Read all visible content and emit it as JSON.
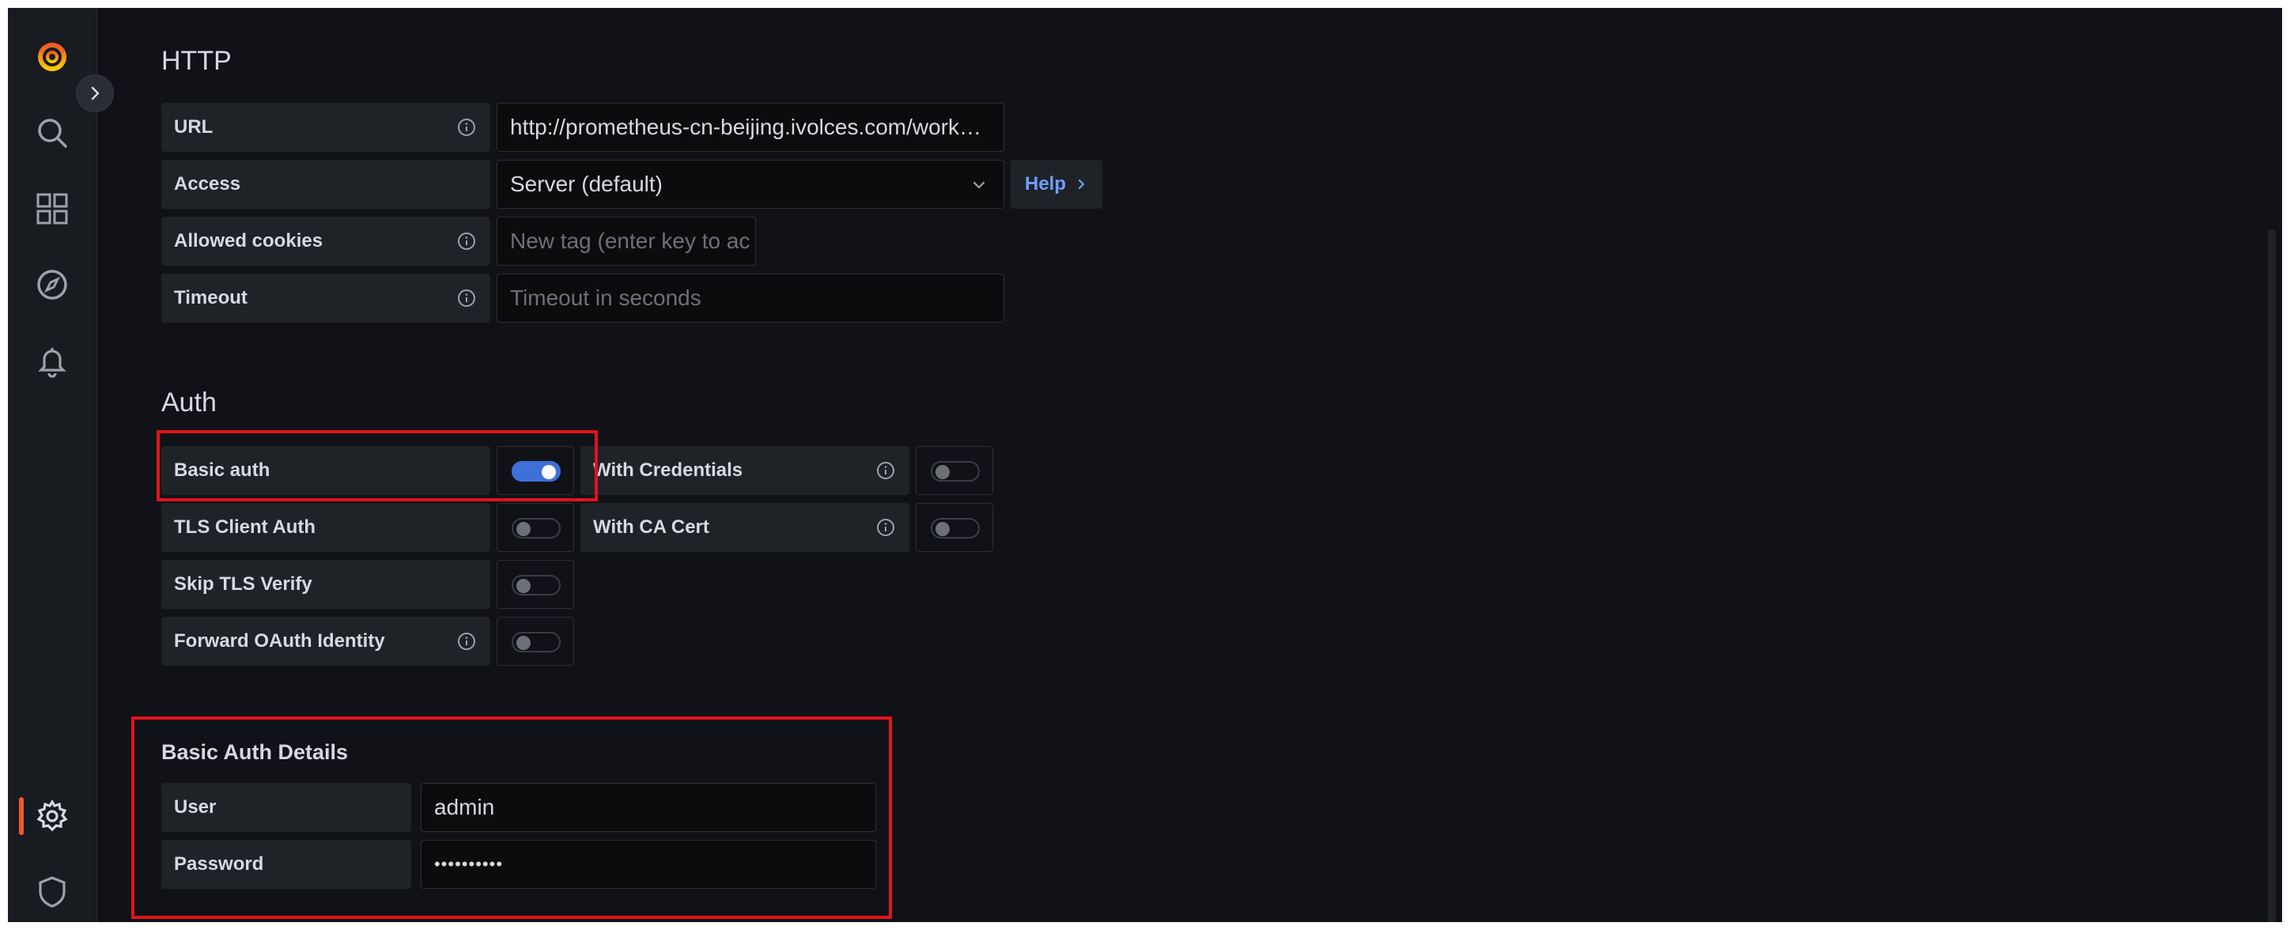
{
  "sidebar": {
    "items": [
      {
        "icon": "grafana-logo-icon"
      },
      {
        "icon": "search-icon"
      },
      {
        "icon": "dashboards-grid-icon"
      },
      {
        "icon": "explore-compass-icon"
      },
      {
        "icon": "alerting-bell-icon"
      },
      {
        "icon": "configuration-gear-icon",
        "active": true
      },
      {
        "icon": "server-admin-shield-icon"
      }
    ],
    "expand_icon": "chevron-right-icon"
  },
  "http": {
    "title": "HTTP",
    "url_label": "URL",
    "url_value": "http://prometheus-cn-beijing.ivolces.com/work…",
    "access_label": "Access",
    "access_value": "Server (default)",
    "help_label": "Help",
    "cookies_label": "Allowed cookies",
    "cookies_placeholder": "New tag (enter key to ac",
    "timeout_label": "Timeout",
    "timeout_placeholder": "Timeout in seconds"
  },
  "auth": {
    "title": "Auth",
    "basic_auth_label": "Basic auth",
    "basic_auth_on": true,
    "with_credentials_label": "With Credentials",
    "with_credentials_on": false,
    "tls_client_auth_label": "TLS Client Auth",
    "tls_client_auth_on": false,
    "with_ca_cert_label": "With CA Cert",
    "with_ca_cert_on": false,
    "skip_tls_label": "Skip TLS Verify",
    "skip_tls_on": false,
    "forward_oauth_label": "Forward OAuth Identity",
    "forward_oauth_on": false
  },
  "basic_auth_details": {
    "title": "Basic Auth Details",
    "user_label": "User",
    "user_value": "admin",
    "password_label": "Password",
    "password_value": "••••••••••"
  },
  "colors": {
    "background": "#111217",
    "panel": "#1f2227",
    "accent_blue": "#3d71d9",
    "link_blue": "#6e9fff",
    "brand_orange": "#f05a28",
    "highlight_red": "#e0141c"
  }
}
